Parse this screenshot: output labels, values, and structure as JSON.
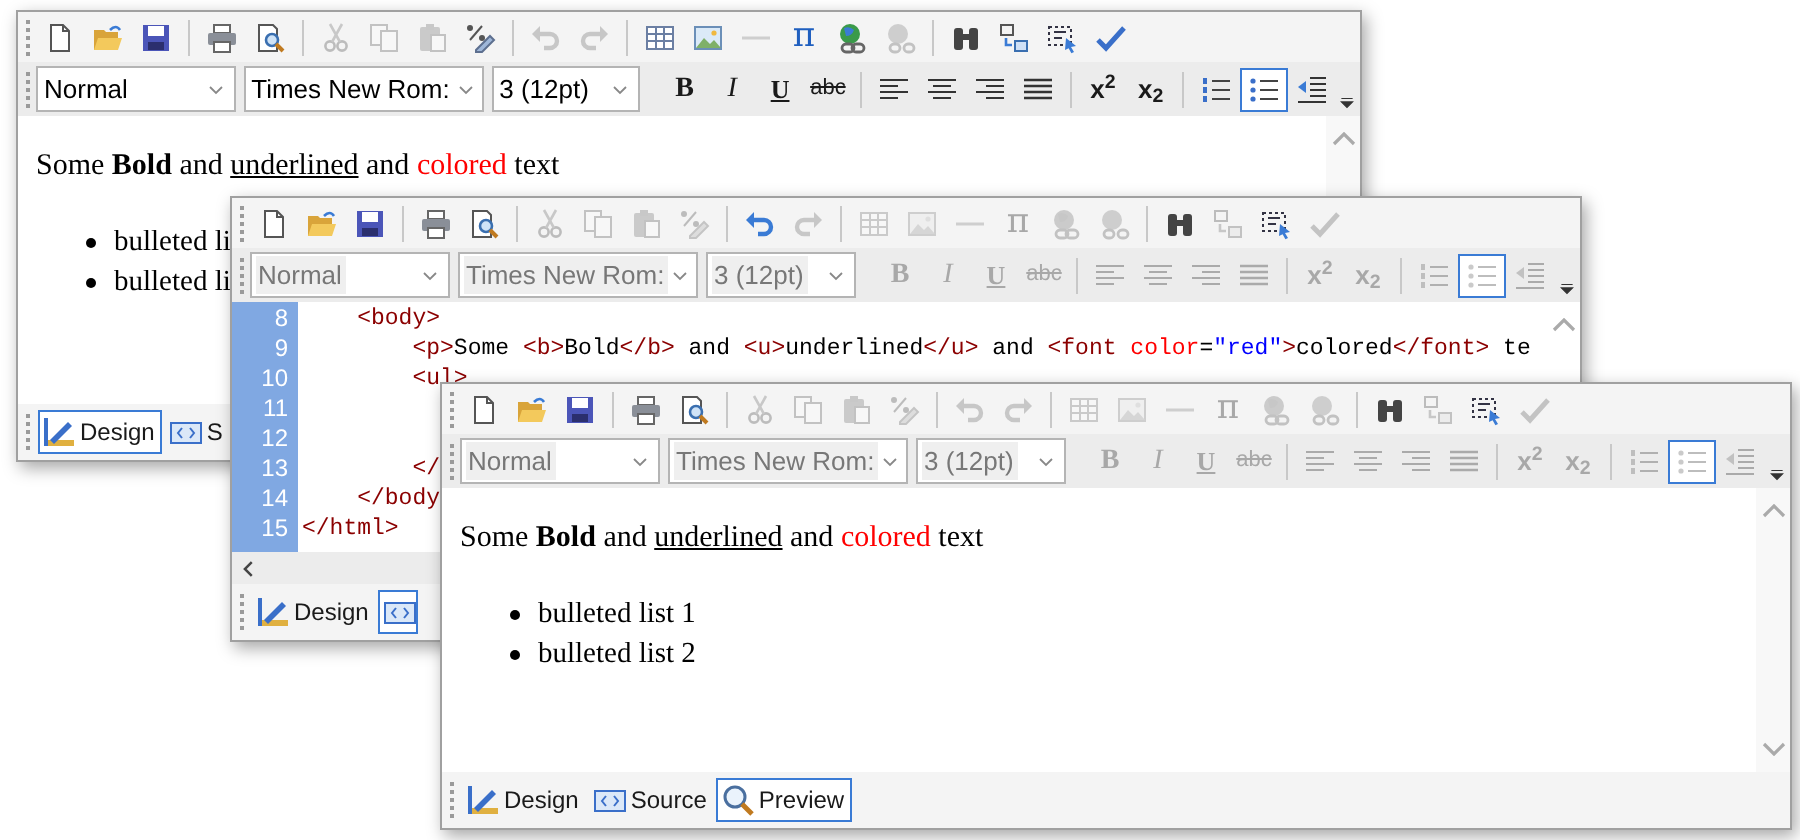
{
  "windows": [
    {
      "kind": "document",
      "toolbar": [
        {
          "kind": "new",
          "disabled": false
        },
        {
          "kind": "open",
          "disabled": false
        },
        {
          "kind": "save",
          "disabled": false
        },
        {
          "kind": "separator"
        },
        {
          "kind": "print",
          "disabled": false
        },
        {
          "kind": "preview",
          "disabled": false
        },
        {
          "kind": "separator"
        },
        {
          "kind": "cut",
          "disabled": true
        },
        {
          "kind": "copy",
          "disabled": true
        },
        {
          "kind": "paste",
          "disabled": true
        },
        {
          "kind": "clean",
          "disabled": false
        },
        {
          "kind": "separator"
        },
        {
          "kind": "undo",
          "disabled": true
        },
        {
          "kind": "redo",
          "disabled": true
        },
        {
          "kind": "separator"
        },
        {
          "kind": "table",
          "disabled": false
        },
        {
          "kind": "image",
          "disabled": false
        },
        {
          "kind": "hr",
          "disabled": true
        },
        {
          "kind": "symbol",
          "label": "π",
          "disabled": false
        },
        {
          "kind": "link",
          "disabled": false
        },
        {
          "kind": "unlink",
          "disabled": true
        },
        {
          "kind": "separator"
        },
        {
          "kind": "find",
          "disabled": false
        },
        {
          "kind": "replace",
          "disabled": false
        },
        {
          "kind": "select",
          "disabled": false
        },
        {
          "kind": "spell",
          "disabled": false
        }
      ],
      "combos": [
        {
          "value": "Normal",
          "disabled": false
        },
        {
          "value": "Times New Rom:",
          "disabled": false
        },
        {
          "value": "3 (12pt)",
          "disabled": false
        }
      ],
      "format": [
        {
          "kind": "bold",
          "label": "B",
          "disabled": false
        },
        {
          "kind": "italic",
          "label": "I",
          "disabled": false
        },
        {
          "kind": "underline",
          "label": "U",
          "disabled": false
        },
        {
          "kind": "strike",
          "label": "abc",
          "disabled": false
        },
        {
          "kind": "separator"
        },
        {
          "kind": "left",
          "disabled": false
        },
        {
          "kind": "center",
          "disabled": false
        },
        {
          "kind": "right",
          "disabled": false
        },
        {
          "kind": "justify",
          "disabled": false
        },
        {
          "kind": "separator"
        },
        {
          "kind": "sup",
          "label": "x$^{2}$",
          "disabled": false
        },
        {
          "kind": "sub",
          "label": "x$_{2}$",
          "disabled": false
        },
        {
          "kind": "separator"
        },
        {
          "kind": "ol",
          "disabled": false,
          "selected": false
        },
        {
          "kind": "ul",
          "disabled": false,
          "selected": true
        },
        {
          "kind": "outdent",
          "disabled": false
        }
      ],
      "paragraph": [
        {
          "text": "Some ",
          "kind": "plain"
        },
        {
          "text": "Bold",
          "kind": "bold"
        },
        {
          "text": " and ",
          "kind": "plain"
        },
        {
          "text": "underlined",
          "kind": "underline"
        },
        {
          "text": " and ",
          "kind": "plain"
        },
        {
          "text": "colored",
          "kind": "colored",
          "color": "#ff0000"
        },
        {
          "text": " text",
          "kind": "plain"
        }
      ],
      "bullets": [
        "bulleted li",
        "bulleted li"
      ],
      "tabs": [
        {
          "kind": "design",
          "label": "Design",
          "selected": true
        },
        {
          "kind": "source",
          "label": "S",
          "selected": false
        }
      ]
    },
    {
      "kind": "source",
      "toolbar": [
        {
          "kind": "new",
          "disabled": false
        },
        {
          "kind": "open",
          "disabled": false
        },
        {
          "kind": "save",
          "disabled": false
        },
        {
          "kind": "separator"
        },
        {
          "kind": "print",
          "disabled": false
        },
        {
          "kind": "preview",
          "disabled": false
        },
        {
          "kind": "separator"
        },
        {
          "kind": "cut",
          "disabled": true
        },
        {
          "kind": "copy",
          "disabled": true
        },
        {
          "kind": "paste",
          "disabled": true
        },
        {
          "kind": "clean",
          "disabled": true
        },
        {
          "kind": "separator"
        },
        {
          "kind": "undo",
          "disabled": false
        },
        {
          "kind": "redo",
          "disabled": true
        },
        {
          "kind": "separator"
        },
        {
          "kind": "table",
          "disabled": true
        },
        {
          "kind": "image",
          "disabled": true
        },
        {
          "kind": "hr",
          "disabled": true
        },
        {
          "kind": "symbol",
          "label": "π",
          "disabled": true
        },
        {
          "kind": "link",
          "disabled": true
        },
        {
          "kind": "unlink",
          "disabled": true
        },
        {
          "kind": "separator"
        },
        {
          "kind": "find",
          "disabled": false
        },
        {
          "kind": "replace",
          "disabled": true
        },
        {
          "kind": "select",
          "disabled": false
        },
        {
          "kind": "spell",
          "disabled": true
        }
      ],
      "combos": [
        {
          "value": "Normal",
          "disabled": true
        },
        {
          "value": "Times New Rom:",
          "disabled": true
        },
        {
          "value": "3 (12pt)",
          "disabled": true
        }
      ],
      "format": [
        {
          "kind": "bold",
          "label": "B",
          "disabled": true
        },
        {
          "kind": "italic",
          "label": "I",
          "disabled": true
        },
        {
          "kind": "underline",
          "label": "U",
          "disabled": true
        },
        {
          "kind": "strike",
          "label": "abc",
          "disabled": true
        },
        {
          "kind": "separator"
        },
        {
          "kind": "left",
          "disabled": true
        },
        {
          "kind": "center",
          "disabled": true
        },
        {
          "kind": "right",
          "disabled": true
        },
        {
          "kind": "justify",
          "disabled": true
        },
        {
          "kind": "separator"
        },
        {
          "kind": "sup",
          "label": "x$^{2}$",
          "disabled": true
        },
        {
          "kind": "sub",
          "label": "x$_{2}$",
          "disabled": true
        },
        {
          "kind": "separator"
        },
        {
          "kind": "ol",
          "disabled": true,
          "selected": false
        },
        {
          "kind": "ul",
          "disabled": true,
          "selected": true
        },
        {
          "kind": "outdent",
          "disabled": true
        }
      ],
      "code_lines": [
        {
          "number": "8",
          "tokens": [
            {
              "text": "    <body>",
              "kind": "tag"
            }
          ]
        },
        {
          "number": "9",
          "tokens": [
            {
              "text": "        <p>",
              "kind": "tag"
            },
            {
              "text": "Some ",
              "kind": "text"
            },
            {
              "text": "<b>",
              "kind": "tag"
            },
            {
              "text": "Bold",
              "kind": "text"
            },
            {
              "text": "</b>",
              "kind": "tag"
            },
            {
              "text": " and ",
              "kind": "text"
            },
            {
              "text": "<u>",
              "kind": "tag"
            },
            {
              "text": "underlined",
              "kind": "text"
            },
            {
              "text": "</u>",
              "kind": "tag"
            },
            {
              "text": " and ",
              "kind": "text"
            },
            {
              "text": "<font ",
              "kind": "tag"
            },
            {
              "text": "color",
              "kind": "attr"
            },
            {
              "text": "=",
              "kind": "text"
            },
            {
              "text": "\"red\"",
              "kind": "value"
            },
            {
              "text": ">",
              "kind": "tag"
            },
            {
              "text": "colored",
              "kind": "text"
            },
            {
              "text": "</font>",
              "kind": "tag"
            },
            {
              "text": " te",
              "kind": "text"
            }
          ]
        },
        {
          "number": "10",
          "tokens": [
            {
              "text": "        <ul>",
              "kind": "tag"
            }
          ]
        },
        {
          "number": "11"
        },
        {
          "number": "12"
        },
        {
          "number": "13",
          "tokens": [
            {
              "text": "        </",
              "kind": "tag"
            }
          ]
        },
        {
          "number": "14",
          "tokens": [
            {
              "text": "    </body",
              "kind": "tag"
            }
          ]
        },
        {
          "number": "15",
          "tokens": [
            {
              "text": "</html>",
              "kind": "tag"
            }
          ]
        }
      ],
      "tabs": [
        {
          "kind": "design",
          "label": "Design",
          "selected": false
        },
        {
          "kind": "source",
          "selected": true
        }
      ]
    },
    {
      "kind": "document",
      "toolbar": [
        {
          "kind": "new",
          "disabled": false
        },
        {
          "kind": "open",
          "disabled": false
        },
        {
          "kind": "save",
          "disabled": false
        },
        {
          "kind": "separator"
        },
        {
          "kind": "print",
          "disabled": false
        },
        {
          "kind": "preview",
          "disabled": false
        },
        {
          "kind": "separator"
        },
        {
          "kind": "cut",
          "disabled": true
        },
        {
          "kind": "copy",
          "disabled": true
        },
        {
          "kind": "paste",
          "disabled": true
        },
        {
          "kind": "clean",
          "disabled": true
        },
        {
          "kind": "separator"
        },
        {
          "kind": "undo",
          "disabled": true
        },
        {
          "kind": "redo",
          "disabled": true
        },
        {
          "kind": "separator"
        },
        {
          "kind": "table",
          "disabled": true
        },
        {
          "kind": "image",
          "disabled": true
        },
        {
          "kind": "hr",
          "disabled": true
        },
        {
          "kind": "symbol",
          "label": "π",
          "disabled": true
        },
        {
          "kind": "link",
          "disabled": true
        },
        {
          "kind": "unlink",
          "disabled": true
        },
        {
          "kind": "separator"
        },
        {
          "kind": "find",
          "disabled": false
        },
        {
          "kind": "replace",
          "disabled": true
        },
        {
          "kind": "select",
          "disabled": false
        },
        {
          "kind": "spell",
          "disabled": true
        }
      ],
      "combos": [
        {
          "value": "Normal",
          "disabled": true
        },
        {
          "value": "Times New Rom:",
          "disabled": true
        },
        {
          "value": "3 (12pt)",
          "disabled": true
        }
      ],
      "format": [
        {
          "kind": "bold",
          "label": "B",
          "disabled": true
        },
        {
          "kind": "italic",
          "label": "I",
          "disabled": true
        },
        {
          "kind": "underline",
          "label": "U",
          "disabled": true
        },
        {
          "kind": "strike",
          "label": "abc",
          "disabled": true
        },
        {
          "kind": "separator"
        },
        {
          "kind": "left",
          "disabled": true
        },
        {
          "kind": "center",
          "disabled": true
        },
        {
          "kind": "right",
          "disabled": true
        },
        {
          "kind": "justify",
          "disabled": true
        },
        {
          "kind": "separator"
        },
        {
          "kind": "sup",
          "label": "x$^{2}$",
          "disabled": true
        },
        {
          "kind": "sub",
          "label": "x$_{2}$",
          "disabled": true
        },
        {
          "kind": "separator"
        },
        {
          "kind": "ol",
          "disabled": true,
          "selected": false
        },
        {
          "kind": "ul",
          "disabled": true,
          "selected": true
        },
        {
          "kind": "outdent",
          "disabled": true
        }
      ],
      "paragraph": [
        {
          "text": "Some ",
          "kind": "plain"
        },
        {
          "text": "Bold",
          "kind": "bold"
        },
        {
          "text": " and ",
          "kind": "plain"
        },
        {
          "text": "underlined",
          "kind": "underline"
        },
        {
          "text": " and ",
          "kind": "plain"
        },
        {
          "text": "colored",
          "kind": "colored",
          "color": "#ff0000"
        },
        {
          "text": " text",
          "kind": "plain"
        }
      ],
      "bullets": [
        "bulleted list 1",
        "bulleted list 2"
      ],
      "tabs": [
        {
          "kind": "design",
          "label": "Design",
          "selected": false
        },
        {
          "kind": "source",
          "label": "Source",
          "selected": false
        },
        {
          "kind": "preview",
          "label": "Preview",
          "selected": true
        }
      ]
    }
  ]
}
